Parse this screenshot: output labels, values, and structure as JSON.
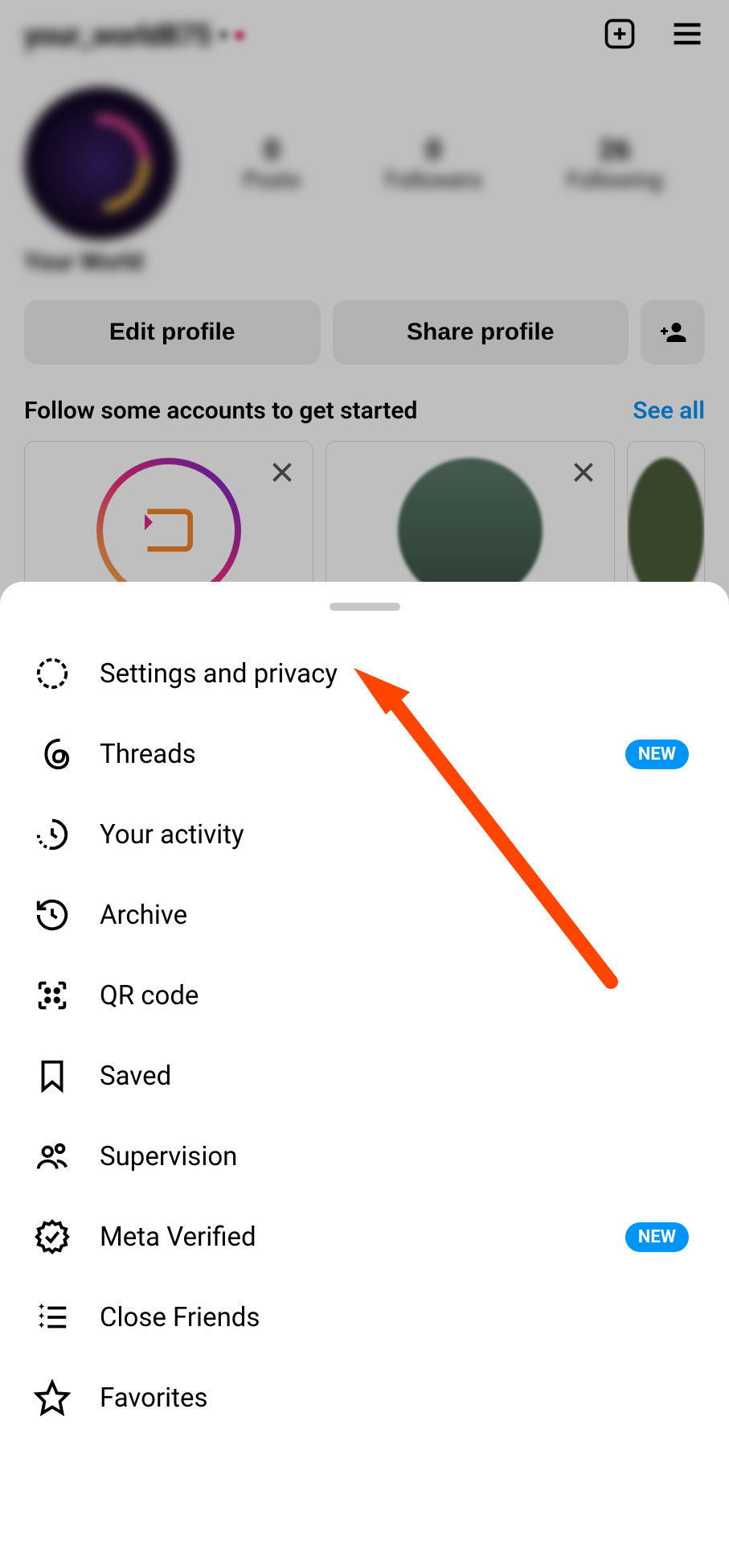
{
  "header": {
    "username": "your_world875",
    "create_icon": "create-post-icon",
    "menu_icon": "hamburger-icon"
  },
  "profile": {
    "display_name": "Your World",
    "stats": [
      {
        "value": "0",
        "label": "Posts"
      },
      {
        "value": "0",
        "label": "Followers"
      },
      {
        "value": "26",
        "label": "Following"
      }
    ]
  },
  "actions": {
    "edit_profile": "Edit profile",
    "share_profile": "Share profile"
  },
  "suggestions": {
    "title": "Follow some accounts to get started",
    "see_all": "See all"
  },
  "sheet": {
    "items": [
      {
        "id": "settings",
        "label": "Settings and privacy",
        "badge": null
      },
      {
        "id": "threads",
        "label": "Threads",
        "badge": "NEW"
      },
      {
        "id": "activity",
        "label": "Your activity",
        "badge": null
      },
      {
        "id": "archive",
        "label": "Archive",
        "badge": null
      },
      {
        "id": "qrcode",
        "label": "QR code",
        "badge": null
      },
      {
        "id": "saved",
        "label": "Saved",
        "badge": null
      },
      {
        "id": "supervision",
        "label": "Supervision",
        "badge": null
      },
      {
        "id": "metaverified",
        "label": "Meta Verified",
        "badge": "NEW"
      },
      {
        "id": "closefriends",
        "label": "Close Friends",
        "badge": null
      },
      {
        "id": "favorites",
        "label": "Favorites",
        "badge": null
      }
    ]
  },
  "annotation": {
    "type": "arrow",
    "color": "#ff4500",
    "points_to": "settings-and-privacy"
  }
}
